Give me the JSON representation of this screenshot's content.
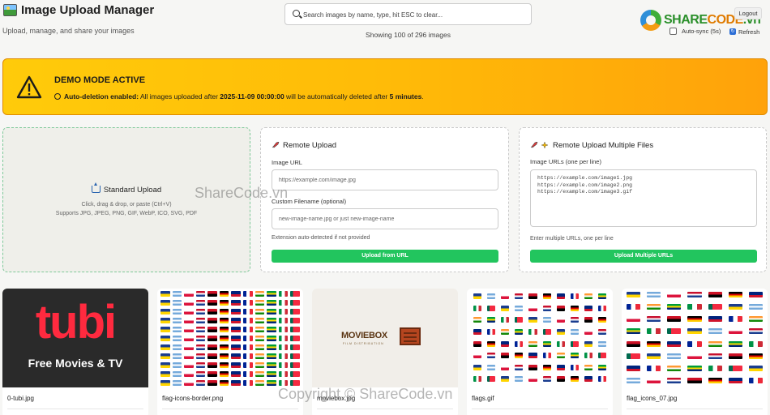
{
  "header": {
    "title": "Image Upload Manager",
    "subtitle": "Upload, manage, and share your images",
    "search_placeholder": "Search images by name, type, hit ESC to clear...",
    "count_text": "Showing 100 of 296 images",
    "logout_label": "Logout",
    "autosync_label": "Auto-sync (5s)",
    "refresh_label": "Refresh"
  },
  "watermark": {
    "logo_part1": "SHARE",
    "logo_part2": "CODE",
    "logo_part3": ".vn",
    "center_text": "ShareCode.vn",
    "bottom_text": "Copyright © ShareCode.vn"
  },
  "banner": {
    "title": "DEMO MODE ACTIVE",
    "label": "Auto-deletion enabled:",
    "msg_part1": " All images uploaded after ",
    "date": "2025-11-09 00:00:00",
    "msg_part2": " will be automatically deleted after ",
    "duration": "5 minutes",
    "msg_end": "."
  },
  "standard_upload": {
    "title": "Standard Upload",
    "hint": "Click, drag & drop, or paste (Ctrl+V)",
    "formats": "Supports JPG, JPEG, PNG, GIF, WebP, ICO, SVG, PDF"
  },
  "remote_upload": {
    "title": "Remote Upload",
    "url_label": "Image URL",
    "url_placeholder": "https://example.com/image.jpg",
    "filename_label": "Custom Filename (optional)",
    "filename_placeholder": "new-image-name.jpg or just new-image-name",
    "hint": "Extension auto-detected if not provided",
    "button": "Upload from URL"
  },
  "multi_upload": {
    "title": "Remote Upload Multiple Files",
    "label": "Image URLs (one per line)",
    "placeholder": "https://example.com/image1.jpg\nhttps://example.com/image2.png\nhttps://example.com/image3.gif",
    "hint": "Enter multiple URLs, one per line",
    "button": "Upload Multiple URLs"
  },
  "cards": [
    {
      "name": "0-tubi.jpg",
      "logo": "tubi",
      "tagline": "Free Movies & TV"
    },
    {
      "name": "flag-icons-border.png"
    },
    {
      "name": "moviebox.jpg",
      "logo": "MOVIEBOX",
      "sub": "FILM DISTRIBUTION"
    },
    {
      "name": "flags.gif"
    },
    {
      "name": "flag_icons_07.jpg"
    }
  ]
}
